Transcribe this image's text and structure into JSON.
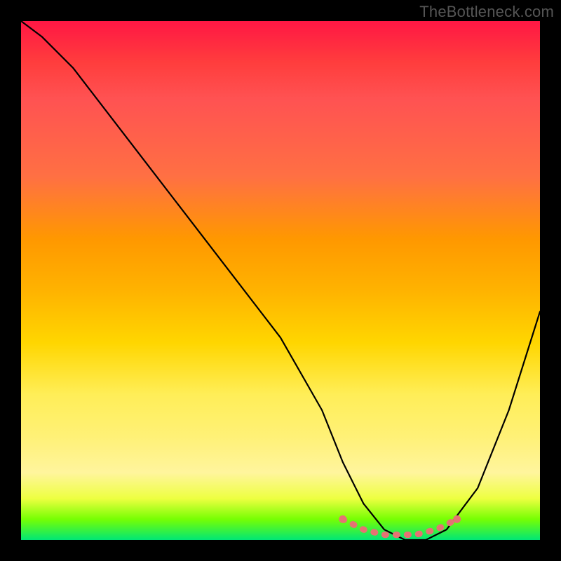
{
  "watermark": "TheBottleneck.com",
  "chart_data": {
    "type": "line",
    "title": "",
    "xlabel": "",
    "ylabel": "",
    "xlim": [
      0,
      100
    ],
    "ylim": [
      0,
      100
    ],
    "grid": false,
    "legend": false,
    "series": [
      {
        "name": "bottleneck-curve",
        "color": "#000000",
        "x": [
          0,
          4,
          10,
          20,
          30,
          40,
          50,
          58,
          62,
          66,
          70,
          74,
          78,
          82,
          88,
          94,
          100
        ],
        "values": [
          100,
          97,
          91,
          78,
          65,
          52,
          39,
          25,
          15,
          7,
          2,
          0,
          0,
          2,
          10,
          25,
          44
        ]
      },
      {
        "name": "optimal-range-marker",
        "color": "#e57373",
        "x": [
          62,
          64,
          66,
          68,
          70,
          72,
          74,
          76,
          78,
          80,
          82,
          84
        ],
        "values": [
          4,
          3,
          2,
          1.5,
          1,
          1,
          1,
          1,
          1.5,
          2,
          3,
          4
        ]
      }
    ],
    "background_gradient": {
      "type": "vertical",
      "stops": [
        {
          "pos": 0.0,
          "color": "#ff1744"
        },
        {
          "pos": 0.3,
          "color": "#ff7043"
        },
        {
          "pos": 0.55,
          "color": "#ffd600"
        },
        {
          "pos": 0.85,
          "color": "#fff59d"
        },
        {
          "pos": 0.96,
          "color": "#76ff03"
        },
        {
          "pos": 1.0,
          "color": "#00e676"
        }
      ]
    }
  }
}
